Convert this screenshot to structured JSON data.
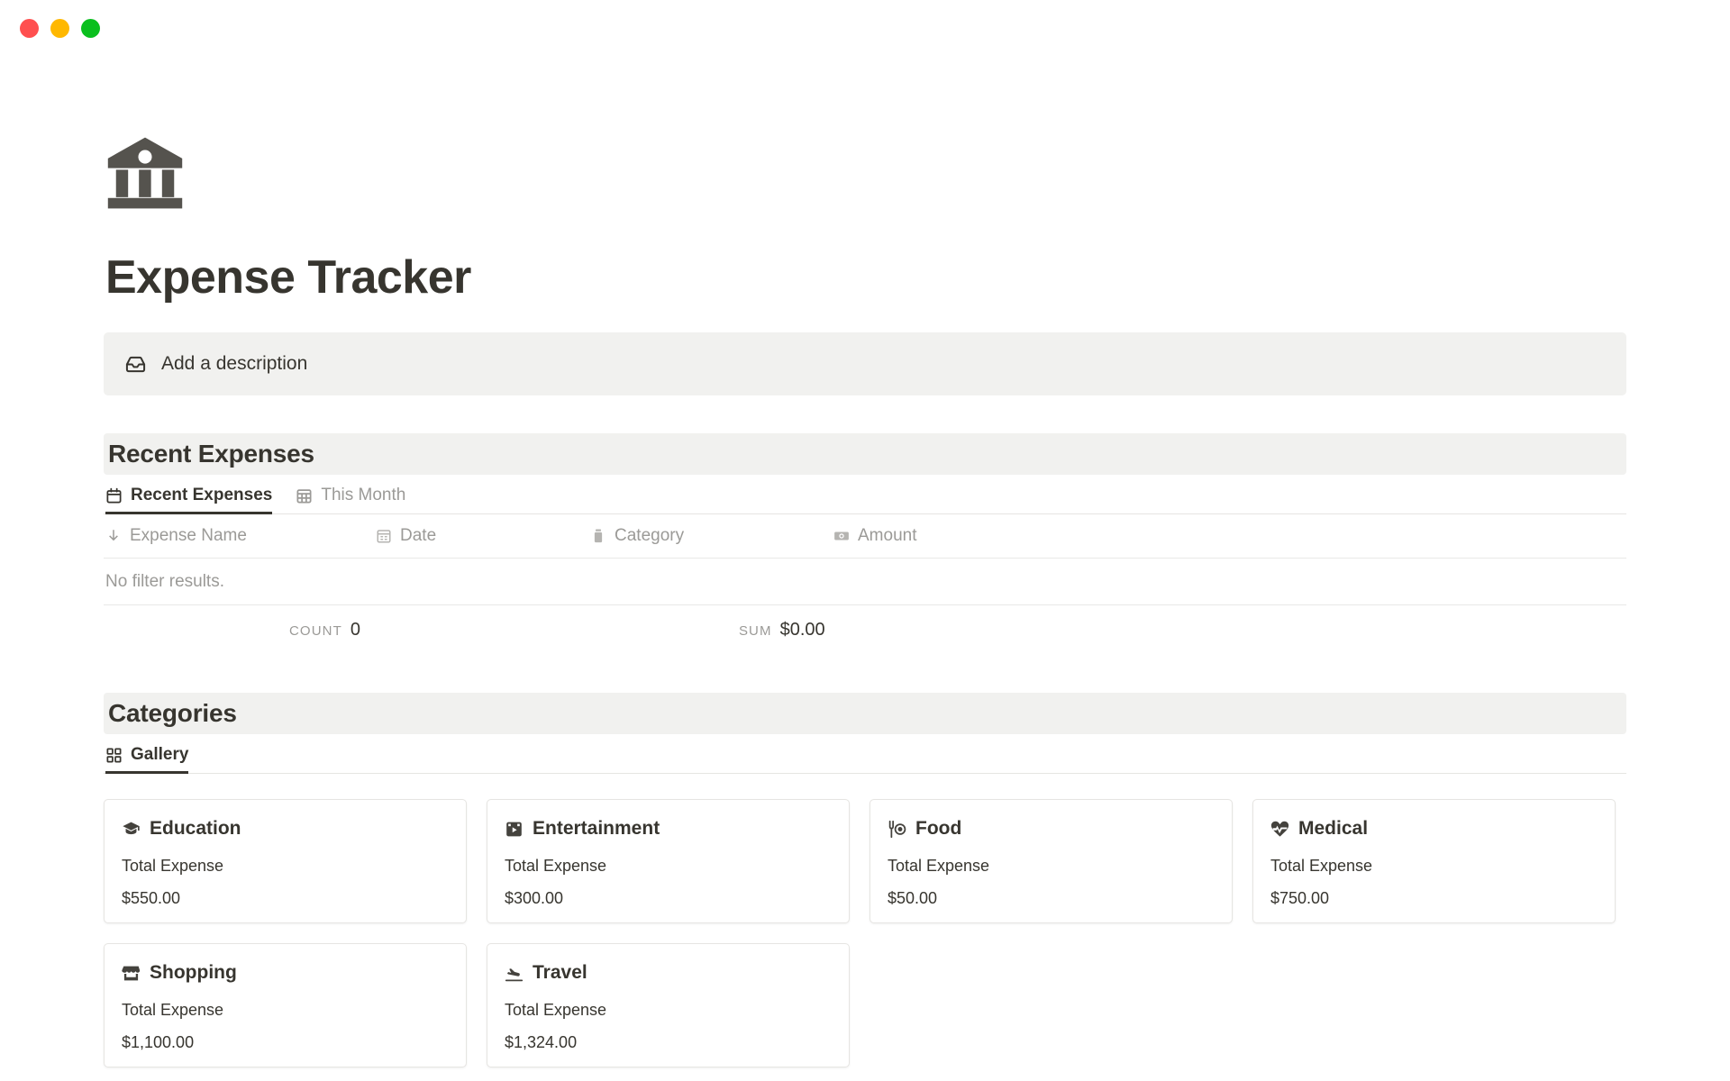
{
  "window": {
    "traffic_lights": [
      {
        "name": "close",
        "color": "#ff4f4f"
      },
      {
        "name": "minimize",
        "color": "#ffb800"
      },
      {
        "name": "maximize",
        "color": "#0abf1e"
      }
    ]
  },
  "page": {
    "icon": "bank-icon",
    "title": "Expense Tracker",
    "description_placeholder": "Add a description",
    "description_icon": "inbox-tray-icon"
  },
  "recent_expenses": {
    "heading": "Recent Expenses",
    "tabs": [
      {
        "label": "Recent Expenses",
        "icon": "calendar-icon",
        "active": true
      },
      {
        "label": "This Month",
        "icon": "calendar-grid-icon",
        "active": false
      }
    ],
    "columns": [
      {
        "label": "Expense Name",
        "icon": "sort-down-arrow-icon"
      },
      {
        "label": "Date",
        "icon": "calendar-small-icon"
      },
      {
        "label": "Category",
        "icon": "category-tag-icon"
      },
      {
        "label": "Amount",
        "icon": "banknote-icon"
      }
    ],
    "empty_message": "No filter results.",
    "aggregates": [
      {
        "label": "COUNT",
        "value": "0"
      },
      {
        "label": "SUM",
        "value": "$0.00"
      }
    ]
  },
  "categories": {
    "heading": "Categories",
    "tabs": [
      {
        "label": "Gallery",
        "icon": "gallery-grid-icon",
        "active": true
      }
    ],
    "field_label": "Total Expense",
    "cards": [
      {
        "title": "Education",
        "icon": "graduation-cap-icon",
        "field_label": "Total Expense",
        "value": "$550.00"
      },
      {
        "title": "Entertainment",
        "icon": "clapperboard-icon",
        "field_label": "Total Expense",
        "value": "$300.00"
      },
      {
        "title": "Food",
        "icon": "utensils-plate-icon",
        "field_label": "Total Expense",
        "value": "$50.00"
      },
      {
        "title": "Medical",
        "icon": "heart-pulse-icon",
        "field_label": "Total Expense",
        "value": "$750.00"
      },
      {
        "title": "Shopping",
        "icon": "store-icon",
        "field_label": "Total Expense",
        "value": "$1,100.00"
      },
      {
        "title": "Travel",
        "icon": "plane-takeoff-icon",
        "field_label": "Total Expense",
        "value": "$1,324.00"
      }
    ]
  },
  "colors": {
    "text_primary": "#37352f",
    "text_muted": "#9b9a97",
    "section_bg": "#f1f1ef",
    "border": "#e6e5e2"
  }
}
